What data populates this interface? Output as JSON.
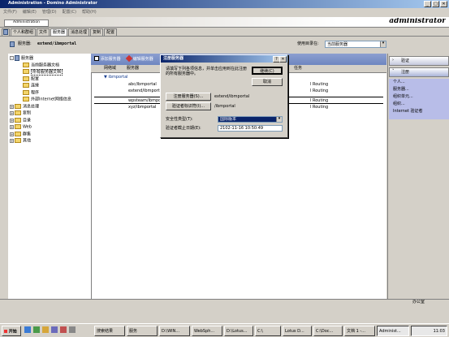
{
  "window": {
    "title": "Administration - Domino Administrator"
  },
  "menu": {
    "items": [
      "文件(F)",
      "编辑(E)",
      "管理(D)",
      "配置(C)",
      "帮助(H)"
    ]
  },
  "header": {
    "tab": "Administration",
    "user": "administrator"
  },
  "tabs": [
    "个人和群组",
    "文件",
    "服务器",
    "消息处理",
    "复制",
    "配置"
  ],
  "nav": {
    "server_label": "服务器:",
    "server_value": "extend/ibmportal",
    "dir_label": "使用目录在:",
    "dir_value": "当前服务器"
  },
  "tree": [
    {
      "label": "服务器",
      "level": 0,
      "twist": "-"
    },
    {
      "label": "当前服务器文档",
      "level": 1
    },
    {
      "label": "所有服务器文档",
      "level": 1,
      "selected": true
    },
    {
      "label": "配置",
      "level": 1
    },
    {
      "label": "连接",
      "level": 1
    },
    {
      "label": "程序",
      "level": 1
    },
    {
      "label": "外部Internet网络信息",
      "level": 1
    },
    {
      "label": "消息处理",
      "level": 0,
      "twist": "+"
    },
    {
      "label": "复制",
      "level": 0,
      "twist": "+"
    },
    {
      "label": "目录",
      "level": 0,
      "twist": "+"
    },
    {
      "label": "Web",
      "level": 0,
      "twist": "+"
    },
    {
      "label": "群集",
      "level": 0,
      "twist": "+"
    },
    {
      "label": "其他",
      "level": 0,
      "twist": "+"
    }
  ],
  "actions": {
    "add_server": "添加服务器",
    "edit_server": "编辑服务器"
  },
  "columns": {
    "domain": "网络域",
    "server": "服务器",
    "task": "任务"
  },
  "rows": [
    {
      "domain": "▼ ibmportal",
      "server": "",
      "task": ""
    },
    {
      "domain": "",
      "server": "abc/ibmportal",
      "task": "l Routing"
    },
    {
      "domain": "",
      "server": "extend/ibmportal",
      "task": "l Routing"
    },
    {
      "domain": "",
      "server": "wpsteam/ibmportal",
      "task": "l Routing"
    },
    {
      "domain": "",
      "server": "xyz/ibmportal",
      "task": "l Routing"
    }
  ],
  "right_panel": {
    "tools_label": "工具",
    "verify": "验证",
    "register": "注册",
    "links": [
      "个人...",
      "服务器...",
      "组织单元...",
      "组织...",
      "Internet 验证者"
    ]
  },
  "dialog": {
    "title": "注册服务器",
    "help_btn": "?",
    "close_btn": "✕",
    "instruction": "请填写下列各项信息，并单击应用到在此注册的所有服务器中。",
    "continue_btn": "继续(C)",
    "cancel_btn": "取消",
    "registration_server_btn": "注册服务器(S)...",
    "registration_server_value": "extend/ibmportal",
    "certifier_btn": "验证者标识符(I)...",
    "certifier_value": "/ibmportal",
    "security_label": "安全性类型(T):",
    "security_value": "国际版本",
    "expiry_label": "验证者截止日期(E):",
    "expiry_value": "2102-11-16 10:50:49"
  },
  "status": {
    "text": "办公室"
  },
  "taskbar": {
    "start": "开始",
    "apps": [
      "搜索结果",
      "服务",
      "D:\\WIN...",
      "WebSph...",
      "D:\\Lotus...",
      "C:\\",
      "Lotus D...",
      "C:\\Doc...",
      "文档 1 -...",
      "Administ..."
    ],
    "clock": "11:03"
  },
  "colors": {
    "title_gradient_start": "#0a246a",
    "action_bar": "#7a8fc8",
    "link_box": "#b8bde8",
    "dialog_bg": "#d4d0c8"
  }
}
